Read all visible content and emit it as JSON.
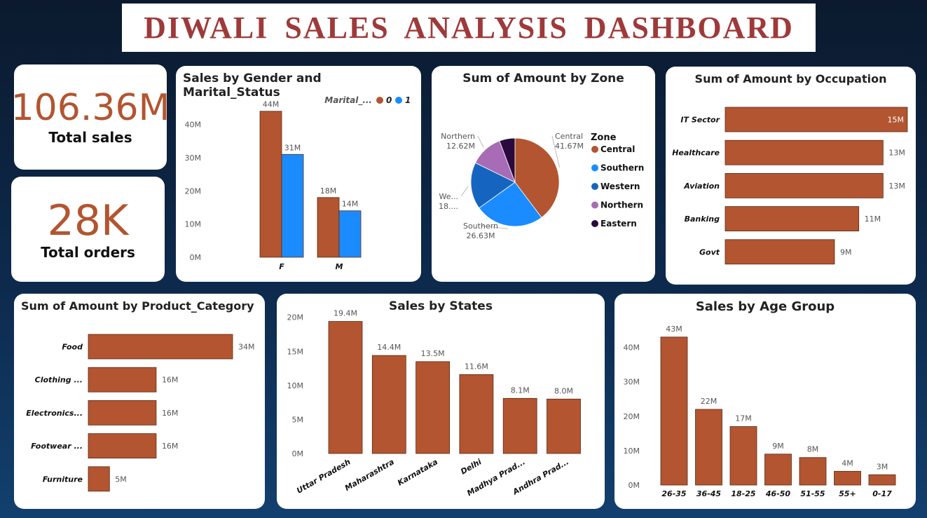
{
  "header": {
    "title": "DIWALI  SALES  ANALYSIS  DASHBOARD"
  },
  "colors": {
    "primary": "#b25530",
    "blue": "#1a8cff"
  },
  "kpis": {
    "total_sales": {
      "value": "106.36M",
      "label": "Total sales"
    },
    "total_orders": {
      "value": "28K",
      "label": "Total orders"
    }
  },
  "chart_data": [
    {
      "id": "gender",
      "type": "bar",
      "title": "Sales by Gender and Marital_Status",
      "legend_title": "Marital_...",
      "categories": [
        "F",
        "M"
      ],
      "series": [
        {
          "name": "0",
          "color": "#b25530",
          "values": [
            44,
            18
          ],
          "labels": [
            "44M",
            "18M"
          ]
        },
        {
          "name": "1",
          "color": "#1a8cff",
          "values": [
            31,
            14
          ],
          "labels": [
            "31M",
            "14M"
          ]
        }
      ],
      "ylim": [
        0,
        45
      ],
      "yticks": [
        0,
        10,
        20,
        30,
        40
      ],
      "ytick_labels": [
        "0M",
        "10M",
        "20M",
        "30M",
        "40M"
      ]
    },
    {
      "id": "zone",
      "type": "pie",
      "title": "Sum of Amount by Zone",
      "legend_title": "Zone",
      "slices": [
        {
          "name": "Central",
          "value": 41.67,
          "color": "#b25530",
          "label": [
            "Central",
            "41.67M"
          ]
        },
        {
          "name": "Southern",
          "value": 26.63,
          "color": "#1a8cff",
          "label": [
            "Southern",
            "26.63M"
          ]
        },
        {
          "name": "Western",
          "value": 18.0,
          "color": "#1565c0",
          "label": [
            "We...",
            "18...."
          ]
        },
        {
          "name": "Northern",
          "value": 12.62,
          "color": "#a86bb5",
          "label": [
            "Northern",
            "12.62M"
          ]
        },
        {
          "name": "Eastern",
          "value": 6.0,
          "color": "#2a0a3d",
          "label": []
        }
      ]
    },
    {
      "id": "occupation",
      "type": "bar",
      "orientation": "horizontal",
      "title": "Sum of Amount by Occupation",
      "categories": [
        "IT Sector",
        "Healthcare",
        "Aviation",
        "Banking",
        "Govt"
      ],
      "values": [
        15,
        13,
        13,
        11,
        9
      ],
      "labels": [
        "15M",
        "13M",
        "13M",
        "11M",
        "9M"
      ],
      "xlim": [
        0,
        15
      ]
    },
    {
      "id": "product",
      "type": "bar",
      "orientation": "horizontal",
      "title": "Sum of Amount by Product_Category",
      "categories": [
        "Food",
        "Clothing ...",
        "Electronics...",
        "Footwear ...",
        "Furniture"
      ],
      "values": [
        34,
        16,
        16,
        16,
        5
      ],
      "labels": [
        "34M",
        "16M",
        "16M",
        "16M",
        "5M"
      ],
      "xlim": [
        0,
        34
      ]
    },
    {
      "id": "states",
      "type": "bar",
      "title": "Sales by States",
      "categories": [
        "Uttar Pradesh",
        "Maharashtra",
        "Karnataka",
        "Delhi",
        "Madhya Prad...",
        "Andhra Prad..."
      ],
      "values": [
        19.4,
        14.4,
        13.5,
        11.6,
        8.1,
        8.0
      ],
      "labels": [
        "19.4M",
        "14.4M",
        "13.5M",
        "11.6M",
        "8.1M",
        "8.0M"
      ],
      "ylim": [
        0,
        21
      ],
      "yticks": [
        0,
        5,
        10,
        15,
        20
      ],
      "ytick_labels": [
        "0M",
        "5M",
        "10M",
        "15M",
        "20M"
      ]
    },
    {
      "id": "age",
      "type": "bar",
      "title": "Sales by Age Group",
      "categories": [
        "26-35",
        "36-45",
        "18-25",
        "46-50",
        "51-55",
        "55+",
        "0-17"
      ],
      "values": [
        43,
        22,
        17,
        9,
        8,
        4,
        3
      ],
      "labels": [
        "43M",
        "22M",
        "17M",
        "9M",
        "8M",
        "4M",
        "3M"
      ],
      "ylim": [
        0,
        45
      ],
      "yticks": [
        0,
        10,
        20,
        30,
        40
      ],
      "ytick_labels": [
        "0M",
        "10M",
        "20M",
        "30M",
        "40M"
      ]
    }
  ]
}
